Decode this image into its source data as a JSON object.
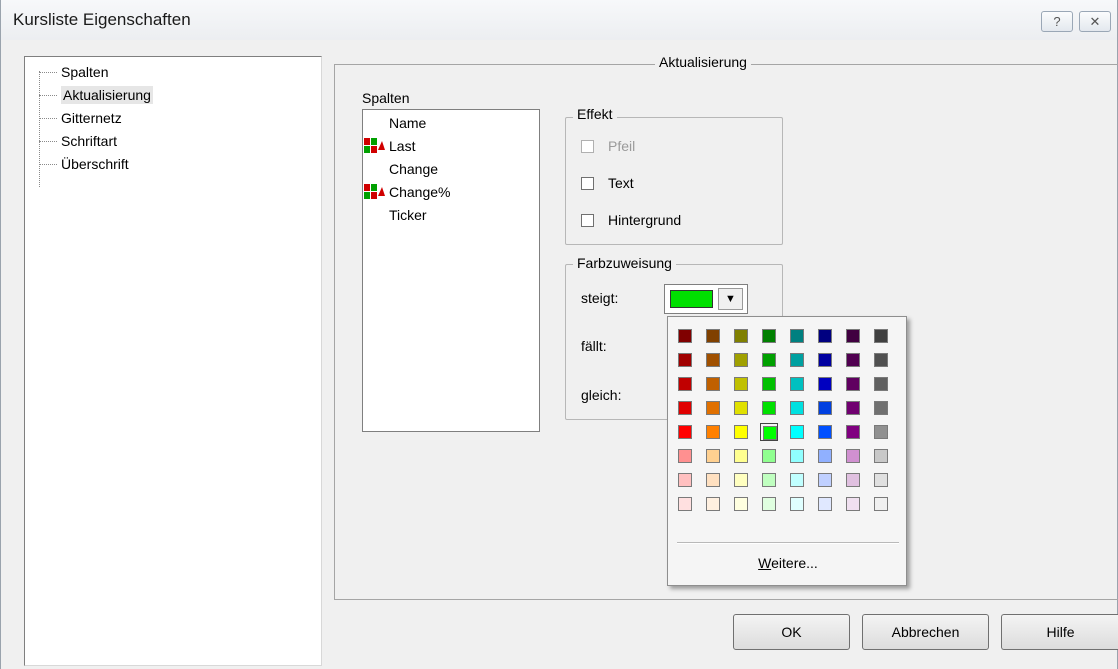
{
  "window": {
    "title": "Kursliste Eigenschaften"
  },
  "titlebar_buttons": {
    "help": "?",
    "close": "✕"
  },
  "tree": {
    "items": [
      {
        "label": "Spalten"
      },
      {
        "label": "Aktualisierung",
        "selected": true
      },
      {
        "label": "Gitternetz"
      },
      {
        "label": "Schriftart"
      },
      {
        "label": "Überschrift"
      }
    ]
  },
  "panel": {
    "title": "Aktualisierung"
  },
  "columns": {
    "label": "Spalten",
    "items": [
      {
        "label": "Name",
        "icon": ""
      },
      {
        "label": "Last",
        "icon": "price-update-icon"
      },
      {
        "label": "Change",
        "icon": ""
      },
      {
        "label": "Change%",
        "icon": "price-update-icon"
      },
      {
        "label": "Ticker",
        "icon": ""
      }
    ]
  },
  "effekt": {
    "title": "Effekt",
    "options": [
      {
        "label": "Pfeil",
        "checked": false,
        "disabled": true
      },
      {
        "label": "Text",
        "checked": false,
        "disabled": false
      },
      {
        "label": "Hintergrund",
        "checked": false,
        "disabled": false
      }
    ]
  },
  "farbzuweisung": {
    "title": "Farbzuweisung",
    "steigt_label": "steigt:",
    "faellt_label": "fällt:",
    "gleich_label": "gleich:",
    "steigt_color": "#00e000"
  },
  "color_popup": {
    "selected": [
      4,
      3
    ],
    "rows": [
      [
        "#800000",
        "#804000",
        "#808000",
        "#008000",
        "#008080",
        "#000080",
        "#400040",
        "#404040"
      ],
      [
        "#a00000",
        "#a05000",
        "#a0a000",
        "#00a000",
        "#00a0a0",
        "#0000a0",
        "#500050",
        "#505050"
      ],
      [
        "#c00000",
        "#c06000",
        "#c0c000",
        "#00c000",
        "#00c0c0",
        "#0000c0",
        "#600060",
        "#606060"
      ],
      [
        "#e00000",
        "#e07000",
        "#e0e000",
        "#00e000",
        "#00e0e0",
        "#0040e0",
        "#700070",
        "#707070"
      ],
      [
        "#ff0000",
        "#ff8000",
        "#ffff00",
        "#00ff00",
        "#00ffff",
        "#0050ff",
        "#800080",
        "#909090"
      ],
      [
        "#ff9090",
        "#ffd090",
        "#ffff90",
        "#90ff90",
        "#90ffff",
        "#90b0ff",
        "#d090d0",
        "#c8c8c8"
      ],
      [
        "#ffc0c0",
        "#ffe0c0",
        "#ffffc0",
        "#c0ffc0",
        "#c0ffff",
        "#c0d0ff",
        "#e0c0e0",
        "#e0e0e0"
      ],
      [
        "#ffe0e0",
        "#fff0e0",
        "#ffffe0",
        "#e0ffe0",
        "#e0ffff",
        "#e0e8ff",
        "#f0e0f0",
        "#f0f0f0"
      ]
    ],
    "more_prefix": "W",
    "more_rest": "eitere..."
  },
  "buttons": {
    "ok": "OK",
    "cancel": "Abbrechen",
    "help": "Hilfe"
  }
}
